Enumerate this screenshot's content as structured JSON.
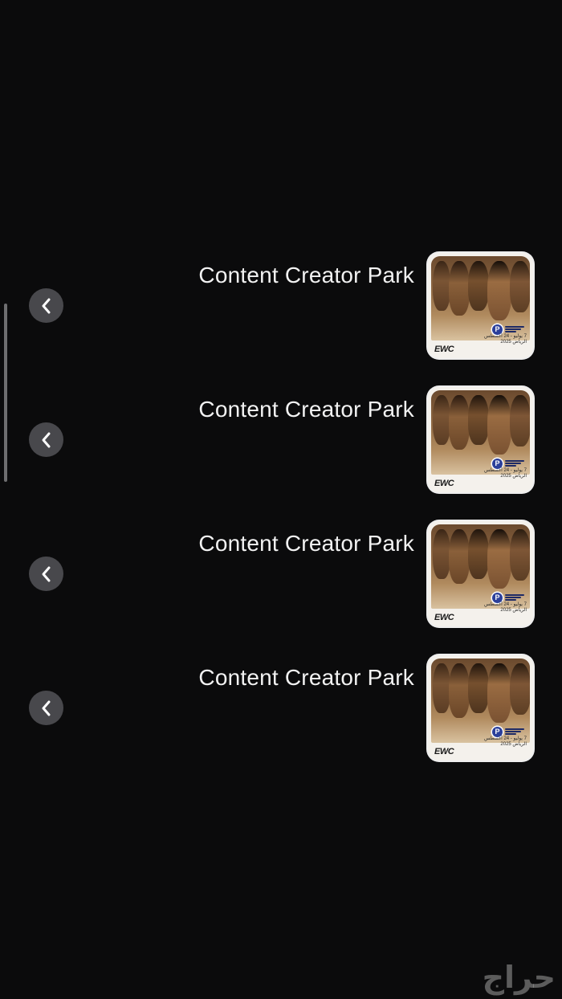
{
  "list": {
    "items": [
      {
        "title": "Content Creator Park",
        "thumbnail_icon": "content-creator-park-poster",
        "logo_text": "EWC",
        "caption_line1": "7 يوليو - 24 أغسطس",
        "caption_line2": "الرياض 2025"
      },
      {
        "title": "Content Creator Park",
        "thumbnail_icon": "content-creator-park-poster",
        "logo_text": "EWC",
        "caption_line1": "7 يوليو - 24 أغسطس",
        "caption_line2": "الرياض 2025"
      },
      {
        "title": "Content Creator Park",
        "thumbnail_icon": "content-creator-park-poster",
        "logo_text": "EWC",
        "caption_line1": "7 يوليو - 24 أغسطس",
        "caption_line2": "الرياض 2025"
      },
      {
        "title": "Content Creator Park",
        "thumbnail_icon": "content-creator-park-poster",
        "logo_text": "EWC",
        "caption_line1": "7 يوليو - 24 أغسطس",
        "caption_line2": "الرياض 2025"
      }
    ],
    "back_icon": "chevron-left-icon"
  },
  "watermark": {
    "text": "حراج"
  },
  "colors": {
    "background": "#0b0b0c",
    "button_bg": "#48484c",
    "text": "#f2f2f2"
  }
}
